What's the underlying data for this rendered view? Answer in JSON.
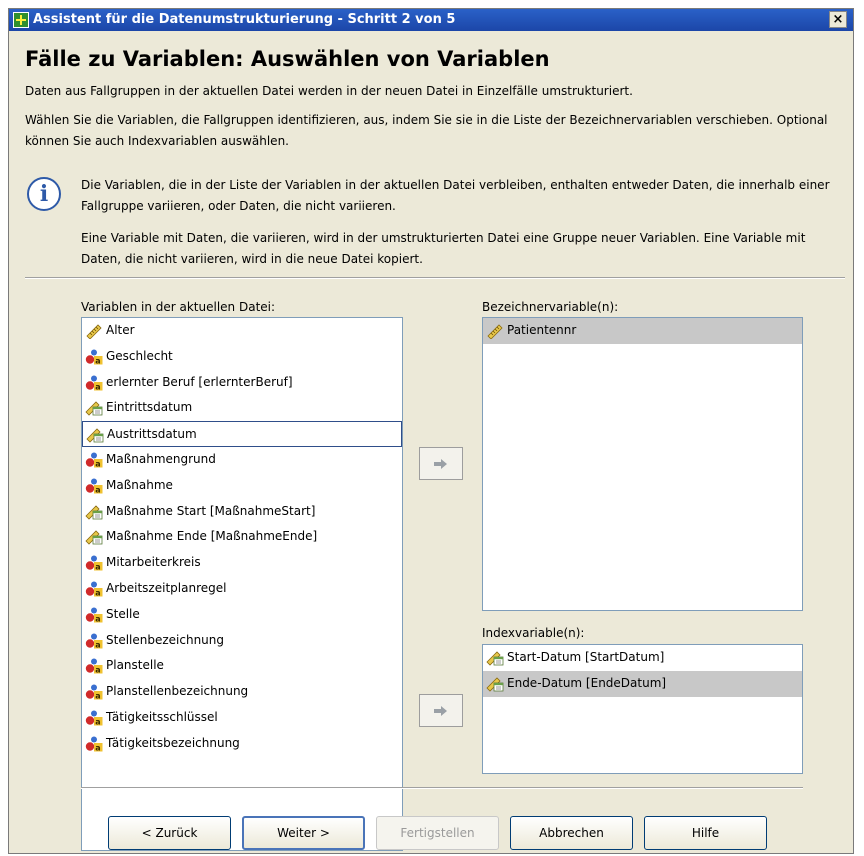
{
  "window": {
    "title": "Assistent für die Datenumstrukturierung - Schritt 2 von 5",
    "close_label": "×"
  },
  "heading": "Fälle zu Variablen: Auswählen von Variablen",
  "intro": "Daten aus Fallgruppen in der aktuellen Datei werden in der neuen Datei in Einzelfälle umstrukturiert.",
  "instruction": "Wählen Sie die Variablen, die Fallgruppen identifizieren, aus, indem Sie sie in die Liste der Bezeichnervariablen verschieben. Optional können Sie auch Indexvariablen auswählen.",
  "info": {
    "icon": "info-icon",
    "p1": "Die Variablen, die in der Liste der Variablen in der aktuellen Datei verbleiben, enthalten entweder Daten, die innerhalb einer Fallgruppe variieren, oder Daten, die nicht variieren.",
    "p2": "Eine Variable mit Daten, die variieren, wird in der umstrukturierten Datei eine Gruppe neuer Variablen. Eine Variable mit Daten, die nicht variieren, wird in die neue Datei kopiert."
  },
  "source_list": {
    "label": "Variablen in der aktuellen Datei:",
    "items": [
      {
        "label": "Alter",
        "icon": "scale-icon"
      },
      {
        "label": "Geschlecht",
        "icon": "nominal-icon"
      },
      {
        "label": "erlernter Beruf [erlernterBeruf]",
        "icon": "nominal-icon"
      },
      {
        "label": "Eintrittsdatum",
        "icon": "date-scale-icon"
      },
      {
        "label": "Austrittsdatum",
        "icon": "date-scale-icon",
        "focused": true
      },
      {
        "label": "Maßnahmengrund",
        "icon": "nominal-icon"
      },
      {
        "label": "Maßnahme",
        "icon": "nominal-icon"
      },
      {
        "label": "Maßnahme Start [MaßnahmeStart]",
        "icon": "date-scale-icon"
      },
      {
        "label": "Maßnahme Ende [MaßnahmeEnde]",
        "icon": "date-scale-icon"
      },
      {
        "label": "Mitarbeiterkreis",
        "icon": "nominal-icon"
      },
      {
        "label": "Arbeitszeitplanregel",
        "icon": "nominal-icon"
      },
      {
        "label": "Stelle",
        "icon": "nominal-icon"
      },
      {
        "label": "Stellenbezeichnung",
        "icon": "nominal-icon"
      },
      {
        "label": "Planstelle",
        "icon": "nominal-icon"
      },
      {
        "label": "Planstellenbezeichnung",
        "icon": "nominal-icon"
      },
      {
        "label": "Tätigkeitsschlüssel",
        "icon": "nominal-icon"
      },
      {
        "label": "Tätigkeitsbezeichnung",
        "icon": "nominal-icon"
      }
    ]
  },
  "identifier_list": {
    "label": "Bezeichnervariable(n):",
    "items": [
      {
        "label": "Patientennr",
        "icon": "scale-icon",
        "selected": true
      }
    ]
  },
  "index_list": {
    "label": "Indexvariable(n):",
    "items": [
      {
        "label": "Start-Datum [StartDatum]",
        "icon": "date-scale-icon"
      },
      {
        "label": "Ende-Datum [EndeDatum]",
        "icon": "date-scale-icon",
        "selected": true
      }
    ]
  },
  "move_buttons": {
    "icon": "arrow-right-icon"
  },
  "buttons": {
    "back": "< Zurück",
    "next": "Weiter >",
    "finish": "Fertigstellen",
    "cancel": "Abbrechen",
    "help": "Hilfe"
  },
  "colors": {
    "title_bar": "#1c46a8",
    "dialog_bg": "#ece9d8",
    "selection": "#c8c8c8",
    "focus_border": "#2f4e8a"
  }
}
